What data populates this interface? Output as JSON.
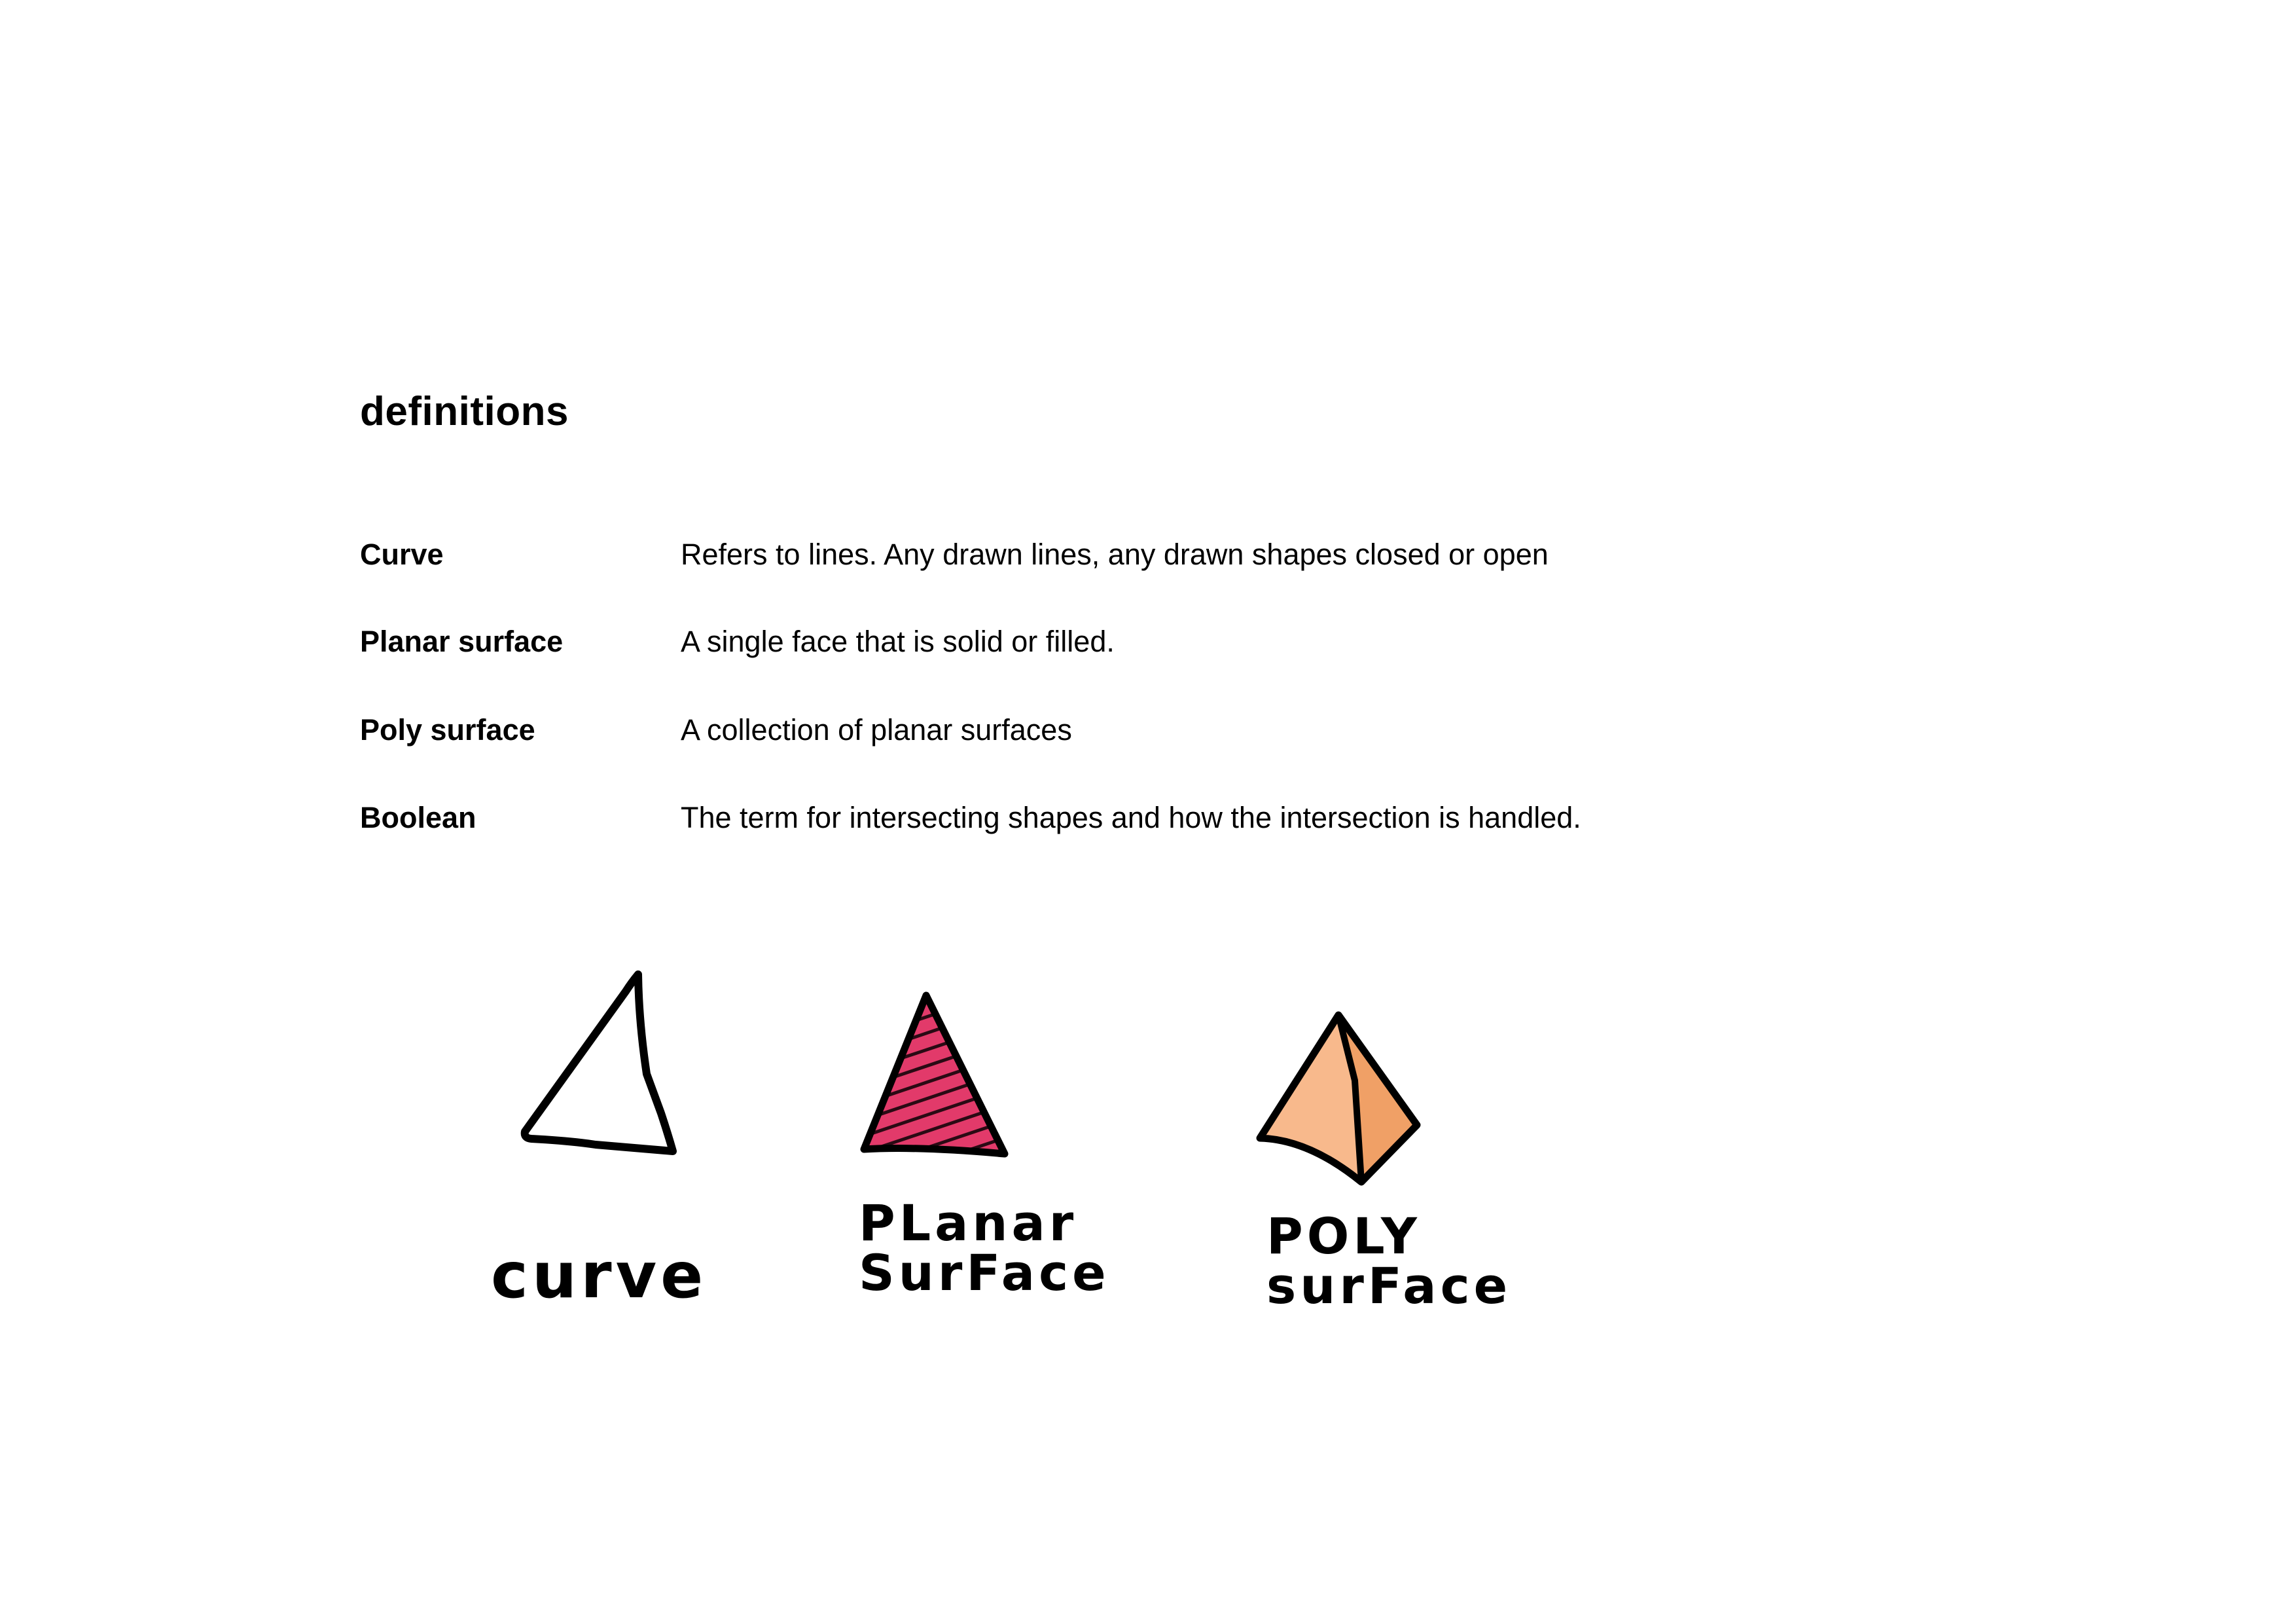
{
  "title": "definitions",
  "definitions": [
    {
      "term": "Curve",
      "meaning": "Refers to lines. Any drawn lines, any drawn shapes closed or open"
    },
    {
      "term": "Planar surface",
      "meaning": "A single face that is solid or filled."
    },
    {
      "term": "Poly surface",
      "meaning": "A collection of planar surfaces"
    },
    {
      "term": "Boolean",
      "meaning": "The term for intersecting shapes and how the intersection is handled."
    }
  ],
  "sketches": [
    {
      "label": "curve",
      "icon": "outline-triangle-icon"
    },
    {
      "label": "PLanar\nSurFace",
      "icon": "hatched-triangle-icon",
      "fill_color": "#e23a6a"
    },
    {
      "label": "POLY\nsurFace",
      "icon": "tetrahedron-icon",
      "fill_color": "#f8b98c",
      "shade_color": "#f0a066"
    }
  ]
}
